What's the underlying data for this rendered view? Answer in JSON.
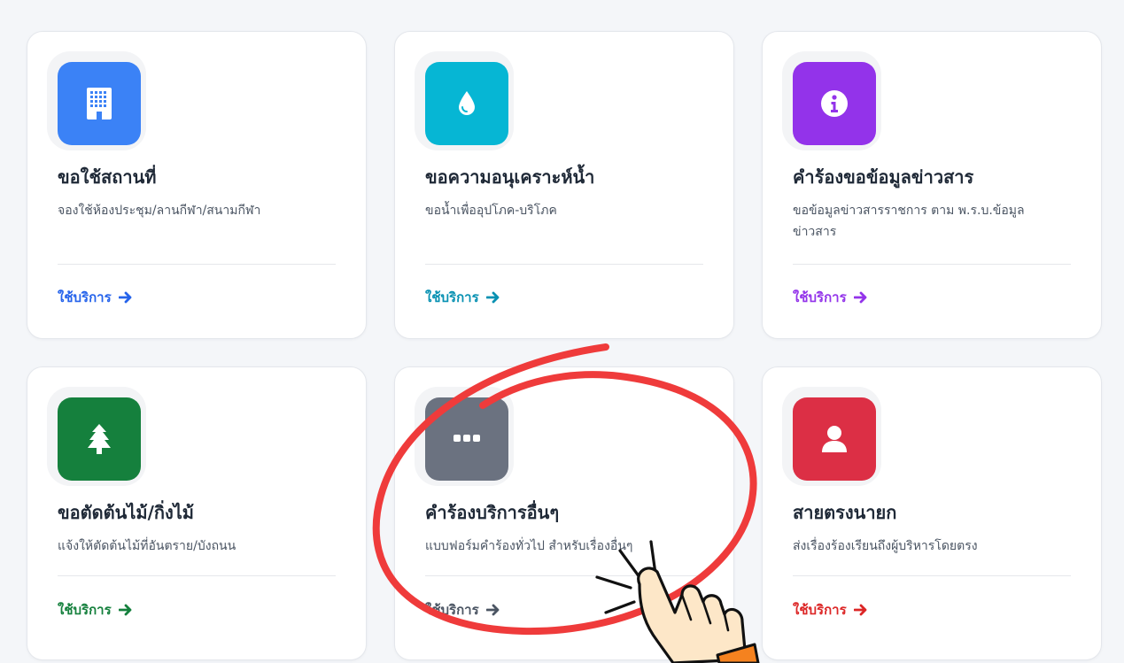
{
  "services": [
    {
      "title": "ขอใช้สถานที่",
      "desc": "จองใช้ห้องประชุม/ลานกีฬา/สนามกีฬา",
      "cta": "ใช้บริการ",
      "icon": "building-icon",
      "icon_color": "#3b82f6",
      "cta_color": "#2563eb"
    },
    {
      "title": "ขอความอนุเคราะห์น้ำ",
      "desc": "ขอน้ำเพื่ออุปโภค-บริโภค",
      "cta": "ใช้บริการ",
      "icon": "water-drop-icon",
      "icon_color": "#06b6d4",
      "cta_color": "#0891b2"
    },
    {
      "title": "คำร้องขอข้อมูลข่าวสาร",
      "desc": "ขอข้อมูลข่าวสารราชการ ตาม พ.ร.บ.ข้อมูลข่าวสาร",
      "cta": "ใช้บริการ",
      "icon": "info-icon",
      "icon_color": "#9333ea",
      "cta_color": "#9333ea"
    },
    {
      "title": "ขอตัดต้นไม้/กิ่งไม้",
      "desc": "แจ้งให้ตัดต้นไม้ที่อันตราย/บังถนน",
      "cta": "ใช้บริการ",
      "icon": "tree-icon",
      "icon_color": "#15803d",
      "cta_color": "#15803d"
    },
    {
      "title": "คำร้องบริการอื่นๆ",
      "desc": "แบบฟอร์มคำร้องทั่วไป สำหรับเรื่องอื่นๆ",
      "cta": "ใช้บริการ",
      "icon": "more-dots-icon",
      "icon_color": "#6b7280",
      "cta_color": "#4b5563"
    },
    {
      "title": "สายตรงนายก",
      "desc": "ส่งเรื่องร้องเรียนถึงผู้บริหารโดยตรง",
      "cta": "ใช้บริการ",
      "icon": "user-icon",
      "icon_color": "#dc2f45",
      "cta_color": "#dc2626"
    }
  ],
  "annotation": {
    "circle_color": "#ef3b3b",
    "hand_icon": "pointing-hand-icon"
  }
}
